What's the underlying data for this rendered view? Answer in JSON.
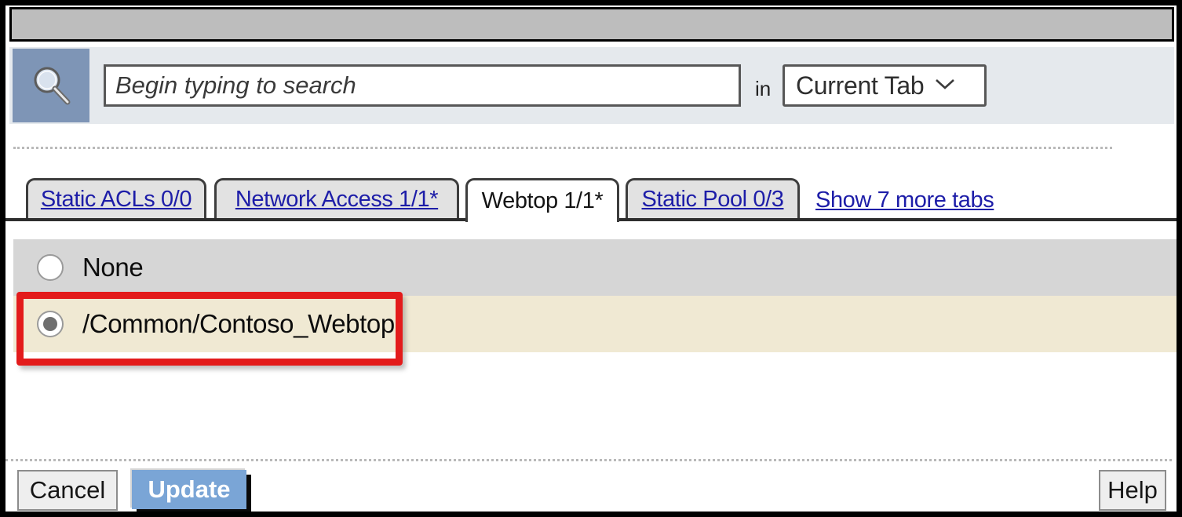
{
  "window": {
    "title_bar_empty": ""
  },
  "search": {
    "icon": "magnifier-icon",
    "placeholder": "Begin typing to search",
    "value": "",
    "in_label": "in",
    "scope_value": "Current Tab",
    "scope_caret": "chevron-down-icon",
    "scope_options": [
      "Current Tab"
    ]
  },
  "tabs": {
    "items": [
      {
        "label": "Static ACLs 0/0",
        "active": false
      },
      {
        "label": "Network Access 1/1*",
        "active": false
      },
      {
        "label": "Webtop 1/1*",
        "active": true
      },
      {
        "label": "Static Pool 0/3",
        "active": false
      }
    ],
    "more_link": "Show 7 more tabs"
  },
  "options": {
    "items": [
      {
        "label": "None",
        "selected": false
      },
      {
        "label": "/Common/Contoso_Webtop",
        "selected": true
      }
    ]
  },
  "annotation": {
    "target": "/Common/Contoso_Webtop",
    "color": "#e31b1b"
  },
  "footer": {
    "cancel_label": "Cancel",
    "update_label": "Update",
    "help_label": "Help"
  },
  "colors": {
    "accent_blue": "#7aa5d6",
    "link_blue": "#1d1da8",
    "selected_row": "#f0e9d3",
    "unselected_row": "#d6d6d6",
    "search_band": "#e5e9ed",
    "title_bar": "#bdbdbd",
    "annotation_red": "#e31b1b"
  }
}
